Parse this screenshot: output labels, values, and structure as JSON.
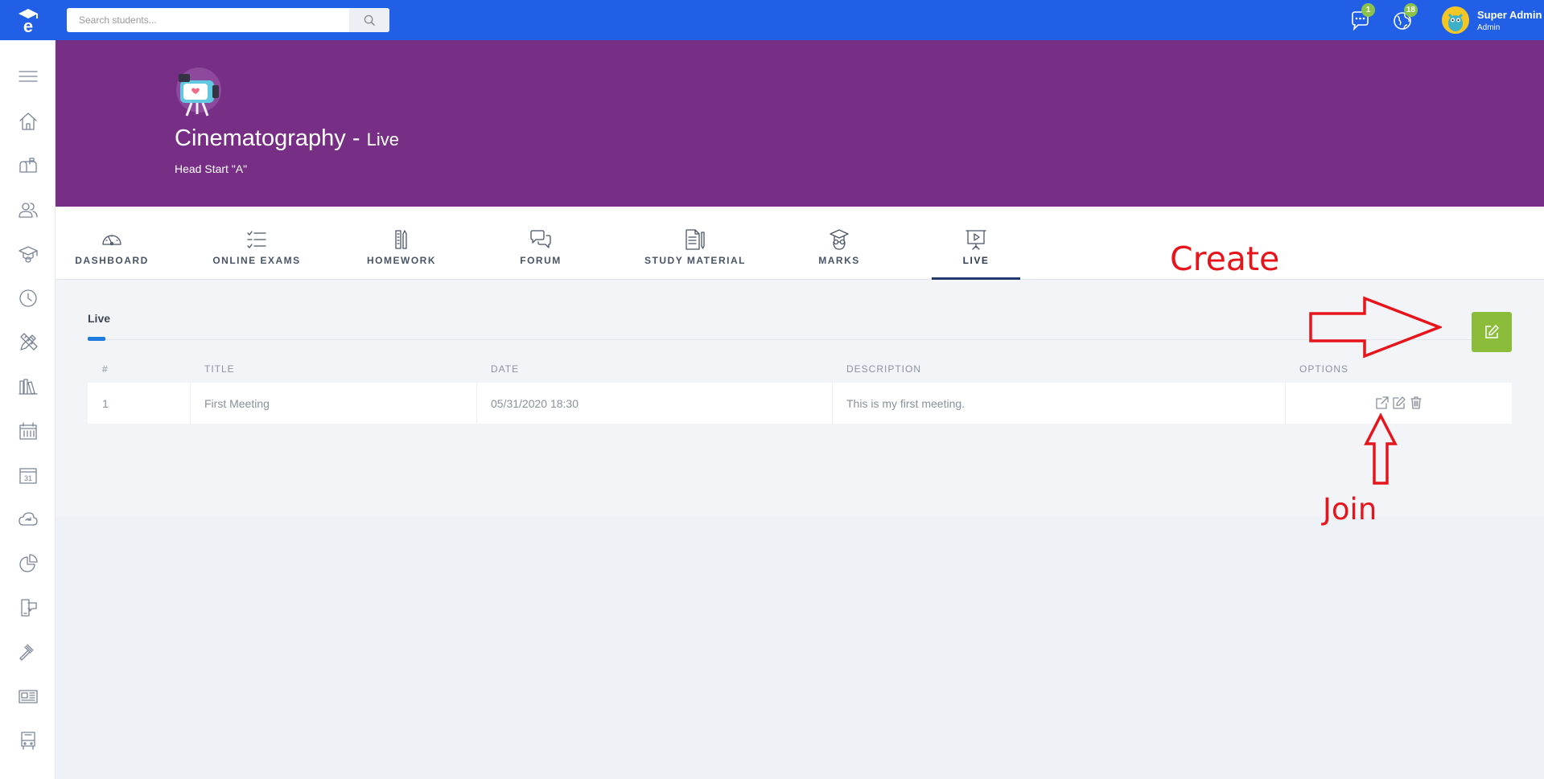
{
  "search": {
    "placeholder": "Search students..."
  },
  "header": {
    "messages_count": "1",
    "notifications_count": "18",
    "user_name": "Super Admin",
    "user_role": "Admin"
  },
  "sidebar": {
    "items": [
      "menu-icon",
      "home-icon",
      "mailbox-icon",
      "users-icon",
      "graduation-cap-icon",
      "clock-icon",
      "pencil-ruler-icon",
      "books-icon",
      "calendar-grid-icon",
      "calendar-31-icon",
      "cloud-sync-icon",
      "pie-chart-icon",
      "mobile-chat-icon",
      "gavel-icon",
      "newspaper-icon",
      "bus-icon"
    ]
  },
  "banner": {
    "course_name": "Cinematography",
    "separator": " - ",
    "section": "Live",
    "group": "Head Start \"A\""
  },
  "tabs": [
    {
      "label": "DASHBOARD",
      "icon": "speedometer-icon"
    },
    {
      "label": "ONLINE EXAMS",
      "icon": "checklist-icon"
    },
    {
      "label": "HOMEWORK",
      "icon": "pencils-icon"
    },
    {
      "label": "FORUM",
      "icon": "chat-bubbles-icon"
    },
    {
      "label": "STUDY MATERIAL",
      "icon": "document-icon"
    },
    {
      "label": "MARKS",
      "icon": "graduate-icon"
    },
    {
      "label": "LIVE",
      "icon": "presentation-play-icon",
      "active": true
    }
  ],
  "content": {
    "section_title": "Live",
    "columns": [
      "#",
      "TITLE",
      "DATE",
      "DESCRIPTION",
      "OPTIONS"
    ],
    "rows": [
      {
        "num": "1",
        "title": "First Meeting",
        "date": "05/31/2020 18:30",
        "description": "This is my first meeting."
      }
    ]
  },
  "annotations": {
    "create": "Create",
    "join": "Join",
    "color": "#e8141c"
  },
  "colors": {
    "topbar": "#2160e6",
    "banner": "#772f86",
    "create_button": "#8bbd3b",
    "badge": "#8bc34a"
  }
}
